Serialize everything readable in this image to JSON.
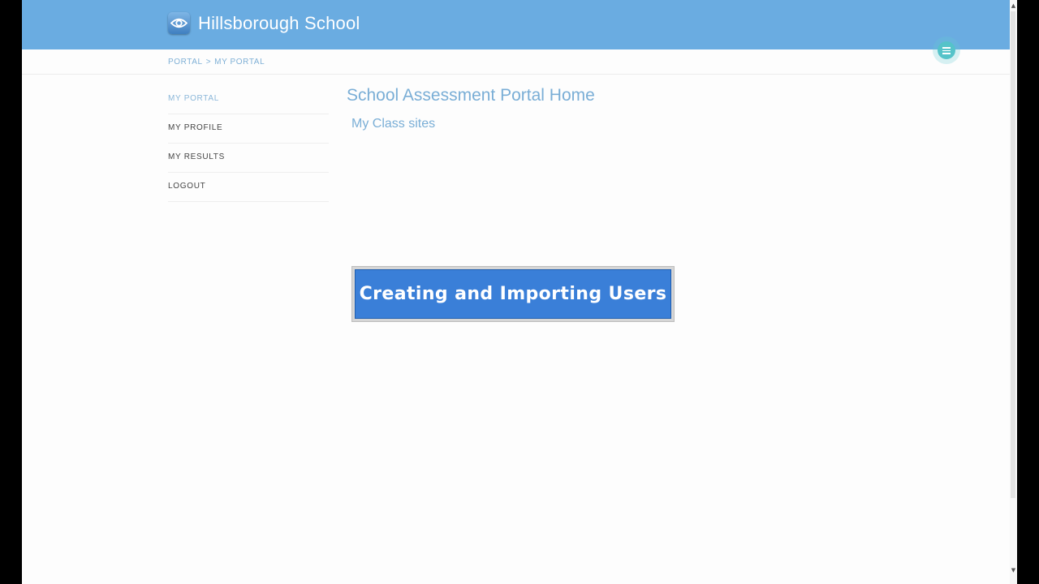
{
  "header": {
    "site_title": "Hillsborough School",
    "logo_icon": "eye-icon",
    "menu_icon": "hamburger-menu-icon",
    "colors": {
      "bar": "#6aace1",
      "menu_button": "#55c3c9"
    }
  },
  "breadcrumb": {
    "items": [
      "PORTAL",
      "MY PORTAL"
    ],
    "separator": ">"
  },
  "sidebar": {
    "items": [
      {
        "label": "MY PORTAL",
        "active": true
      },
      {
        "label": "MY PROFILE",
        "active": false
      },
      {
        "label": "MY RESULTS",
        "active": false
      },
      {
        "label": "LOGOUT",
        "active": false
      }
    ]
  },
  "main": {
    "title": "School Assessment Portal Home",
    "subtitle": "My Class sites"
  },
  "banner": {
    "text": "Creating and Importing Users",
    "color": "#3a7fd8"
  }
}
